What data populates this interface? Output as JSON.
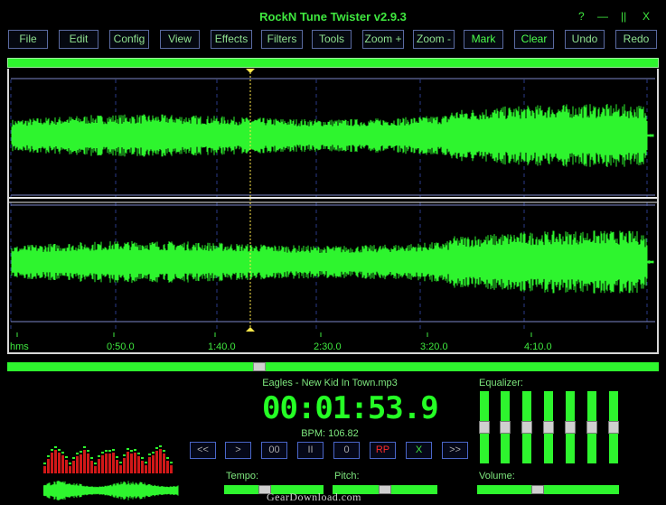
{
  "app": {
    "title": "RockN Tune Twister v2.9.3"
  },
  "window_controls": [
    {
      "name": "help",
      "label": "?"
    },
    {
      "name": "minimize",
      "label": "—"
    },
    {
      "name": "pause",
      "label": "||"
    },
    {
      "name": "close",
      "label": "X"
    }
  ],
  "menu": [
    {
      "label": "File"
    },
    {
      "label": "Edit"
    },
    {
      "label": "Config"
    },
    {
      "label": "View"
    },
    {
      "label": "Effects"
    },
    {
      "label": "Filters"
    },
    {
      "label": "Tools"
    },
    {
      "label": "Zoom +"
    },
    {
      "label": "Zoom -"
    },
    {
      "label": "Mark"
    },
    {
      "label": "Clear"
    },
    {
      "label": "Undo"
    },
    {
      "label": "Redo"
    }
  ],
  "timeline": {
    "labels": [
      "hms",
      "0:50.0",
      "1:40.0",
      "2:30.0",
      "3:20.0",
      "4:10.0"
    ]
  },
  "playhead": {
    "position_fraction": 0.373
  },
  "scroll_position_fraction": 0.385,
  "track": {
    "filename": "Eagles - New Kid In Town.mp3",
    "time": "00:01:53.9",
    "bpm_label": "BPM: 106.82"
  },
  "transport": [
    {
      "name": "rewind",
      "label": "<<"
    },
    {
      "name": "play",
      "label": ">"
    },
    {
      "name": "zero",
      "label": "00"
    },
    {
      "name": "pause",
      "label": "II"
    },
    {
      "name": "stop",
      "label": "0"
    },
    {
      "name": "repeat",
      "label": "RP"
    },
    {
      "name": "cancel",
      "label": "X"
    },
    {
      "name": "forward",
      "label": ">>"
    }
  ],
  "sliders": {
    "tempo_label": "Tempo:",
    "tempo_value": 0.4,
    "pitch_label": "Pitch:",
    "pitch_value": 0.5,
    "volume_label": "Volume:",
    "volume_value": 0.42
  },
  "equalizer": {
    "label": "Equalizer:",
    "bands": [
      0.5,
      0.5,
      0.5,
      0.5,
      0.5,
      0.5,
      0.5
    ]
  },
  "colors": {
    "wave": "#2ef52e",
    "accent": "#3fe83f",
    "button_border": "#5a6aa0",
    "rp_red": "#ff2a2a",
    "playhead": "#ffe94a"
  },
  "watermark": "GearDownload.com"
}
